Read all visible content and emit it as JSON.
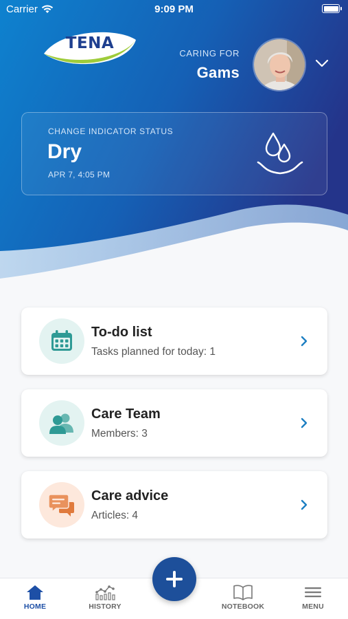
{
  "status_bar": {
    "carrier": "Carrier",
    "time": "9:09 PM"
  },
  "brand": {
    "logo_text": "TENA",
    "colors": {
      "primary_blue": "#1d4f9a",
      "hero_dark": "#1e3a8a",
      "hero_light": "#0f7fd0",
      "teal_icon": "#2e9a95",
      "teal_bg": "#e3f3f1",
      "orange_icon": "#e07a3c",
      "orange_bg": "#fde8dc",
      "link_blue": "#1d7fc2"
    }
  },
  "header": {
    "caring_for_label": "CARING FOR",
    "caring_for_name": "Gams",
    "dropdown_icon": "chevron-down-icon"
  },
  "indicator": {
    "caption": "CHANGE INDICATOR STATUS",
    "state": "Dry",
    "timestamp": "APR 7, 4:05 PM",
    "icon": "water-drop-icon"
  },
  "cards": [
    {
      "title": "To-do list",
      "subtitle": "Tasks planned for today: 1",
      "icon": "calendar-icon"
    },
    {
      "title": "Care Team",
      "subtitle": "Members: 3",
      "icon": "people-icon"
    },
    {
      "title": "Care advice",
      "subtitle": "Articles: 4",
      "icon": "chat-bubbles-icon"
    }
  ],
  "tabbar": {
    "active": "HOME",
    "items": [
      {
        "label": "HOME",
        "icon": "home-icon"
      },
      {
        "label": "HISTORY",
        "icon": "chart-icon"
      },
      {
        "label": "NOTEBOOK",
        "icon": "book-icon"
      },
      {
        "label": "MENU",
        "icon": "hamburger-icon"
      }
    ],
    "fab_icon": "plus-icon"
  }
}
